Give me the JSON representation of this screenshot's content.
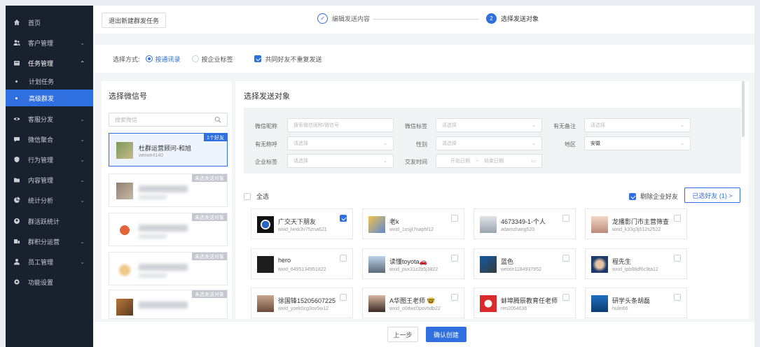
{
  "sidebar": {
    "items": [
      {
        "label": "首页",
        "icon": "home-icon",
        "arrow": ""
      },
      {
        "label": "客户管理",
        "icon": "users-icon",
        "arrow": "⌄"
      },
      {
        "label": "任务管理",
        "icon": "task-icon",
        "arrow": "⌃"
      },
      {
        "label": "客服分发",
        "icon": "eye-icon",
        "arrow": "⌄"
      },
      {
        "label": "微信聚合",
        "icon": "chat-icon",
        "arrow": "⌄"
      },
      {
        "label": "行为管理",
        "icon": "shield-icon",
        "arrow": "⌄"
      },
      {
        "label": "内容管理",
        "icon": "folder-icon",
        "arrow": "⌄"
      },
      {
        "label": "统计分析",
        "icon": "pie-icon",
        "arrow": "⌄"
      },
      {
        "label": "群活跃统计",
        "icon": "group-icon",
        "arrow": ""
      },
      {
        "label": "群积分运营",
        "icon": "coins-icon",
        "arrow": "⌄"
      },
      {
        "label": "员工管理",
        "icon": "person-icon",
        "arrow": "⌄"
      },
      {
        "label": "功能设置",
        "icon": "gear-icon",
        "arrow": ""
      }
    ],
    "sub_items": [
      {
        "label": "计划任务"
      },
      {
        "label": "高级群发"
      }
    ]
  },
  "topbar": {
    "exit_label": "退出新建群发任务",
    "step1_label": "编辑发送内容",
    "step2_num": "2",
    "step2_label": "选择发送对象"
  },
  "mode": {
    "label": "选择方式:",
    "option1": "按通讯录",
    "option2": "按企业标签",
    "dedupe": "共同好友不重复发送"
  },
  "wx_panel": {
    "title": "选择微信号",
    "search_placeholder": "搜索微信",
    "accounts": [
      {
        "name": "杜群运营顾问-和旭",
        "id": "weiwe4140",
        "tag": "1个好友",
        "selected": true
      },
      {
        "name": "",
        "id": "",
        "tag": "未选发送对象",
        "selected": false
      },
      {
        "name": "",
        "id": "",
        "tag": "未选发送对象",
        "selected": false
      },
      {
        "name": "",
        "id": "",
        "tag": "未选发送对象",
        "selected": false
      },
      {
        "name": "",
        "id": "",
        "tag": "未选发送对象",
        "selected": false
      }
    ]
  },
  "target_panel": {
    "title": "选择发送对象",
    "filters": {
      "nickname_label": "微信昵称",
      "nickname_placeholder": "搜索微信昵称/微信号",
      "tag_label": "微信标签",
      "tag_placeholder": "请选择",
      "remark_label": "有无备注",
      "remark_placeholder": "请选择",
      "greet_label": "有无称呼",
      "greet_placeholder": "请选择",
      "gender_label": "性别",
      "gender_placeholder": "请选择",
      "region_label": "地区",
      "region_value": "安徽",
      "ent_tag_label": "企业标签",
      "ent_tag_placeholder": "请选择",
      "time_label": "交友时间",
      "start_placeholder": "开始日期",
      "date_sep": "~",
      "end_placeholder": "结束日期"
    },
    "select_all": "全选",
    "delete_enterprise": "剔除企业好友",
    "chosen_button": "已选好友 (1) >",
    "friends": [
      {
        "name": "广交天下朋友",
        "id": "wxid_lwxk3v75zna621",
        "checked": true,
        "avatar": "bmw"
      },
      {
        "name": "老k",
        "id": "wxid_1xsjjt7naphf12",
        "checked": false,
        "avatar": "icons"
      },
      {
        "name": "4673349-1-个人",
        "id": "adamzhang520",
        "checked": false,
        "avatar": "person"
      },
      {
        "name": "龙播影门市主营筛查",
        "id": "wxid_k33g3j512s2522",
        "checked": false,
        "avatar": "girl"
      },
      {
        "name": "hero",
        "id": "wxid_6495134951822",
        "checked": false,
        "avatar": "dark"
      },
      {
        "name": "读懂toyota🚗",
        "id": "wxid_pux31z2b5j3822",
        "checked": false,
        "avatar": "car"
      },
      {
        "name": "蓝色",
        "id": "weixin1184937952",
        "checked": false,
        "avatar": "blue"
      },
      {
        "name": "程先生",
        "id": "wxid_ipb88df6c9ta12",
        "checked": false,
        "avatar": "portrait"
      },
      {
        "name": "徐国锋15205607225",
        "id": "wxid_yoek0cg3ov5w12",
        "checked": false,
        "avatar": "man"
      },
      {
        "name": "A华图王老师 🤓",
        "id": "wxid_o0dwc0povhdb22",
        "checked": false,
        "avatar": "teacher"
      },
      {
        "name": "蚌埠腾辰教育任老师",
        "id": "ren2054636",
        "checked": false,
        "avatar": "logo"
      },
      {
        "name": "研学头条胡磊",
        "id": "hulei66",
        "checked": false,
        "avatar": "stage"
      }
    ]
  },
  "bottom": {
    "prev_label": "上一步",
    "confirm_label": "确认创建"
  },
  "colors": {
    "sidebar_bg": "#19202e",
    "accent": "#2f6fdf",
    "tag_gray": "#c3c7ce"
  }
}
